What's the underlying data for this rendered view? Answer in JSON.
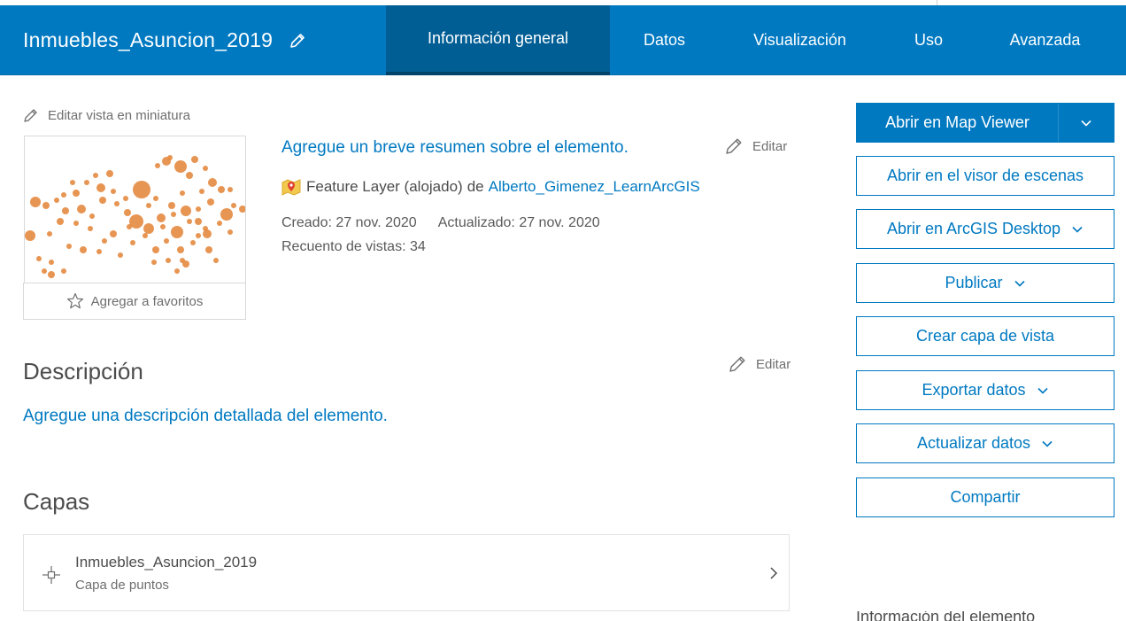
{
  "header": {
    "title": "Inmuebles_Asuncion_2019",
    "tabs": [
      {
        "label": "Información general",
        "active": true
      },
      {
        "label": "Datos",
        "active": false
      },
      {
        "label": "Visualización",
        "active": false
      },
      {
        "label": "Uso",
        "active": false
      },
      {
        "label": "Avanzada",
        "active": false
      }
    ]
  },
  "thumbnail": {
    "edit_label": "Editar vista en miniatura",
    "favorite_label": "Agregar a favoritos"
  },
  "summary": {
    "text": "Agregue un breve resumen sobre el elemento.",
    "edit_label": "Editar"
  },
  "item": {
    "type": "Feature Layer (alojado)",
    "by": "de",
    "owner": "Alberto_Gimenez_LearnArcGIS",
    "created": "Creado: 27 nov. 2020",
    "updated": "Actualizado: 27 nov. 2020",
    "views": "Recuento de vistas: 34"
  },
  "description": {
    "heading": "Descripción",
    "edit_label": "Editar",
    "placeholder_link": "Agregue una descripción detallada del elemento."
  },
  "layers": {
    "heading": "Capas",
    "items": [
      {
        "name": "Inmuebles_Asuncion_2019",
        "type": "Capa de puntos"
      }
    ]
  },
  "actions": {
    "open_map_viewer": "Abrir en Map Viewer",
    "open_scene_viewer": "Abrir en el visor de escenas",
    "open_desktop": "Abrir en ArcGIS Desktop",
    "publish": "Publicar",
    "create_view": "Crear capa de vista",
    "export": "Exportar datos",
    "update": "Actualizar datos",
    "share": "Compartir"
  },
  "sidebar_cutoff_text": "Información del elemento",
  "colors": {
    "brand": "#0079c1",
    "tab_active": "#005e95",
    "point": "#e48a40"
  },
  "icons": [
    "pencil-icon",
    "star-icon",
    "feature-layer-icon",
    "chevron-down-icon",
    "chevron-right-icon",
    "point-layer-icon"
  ]
}
